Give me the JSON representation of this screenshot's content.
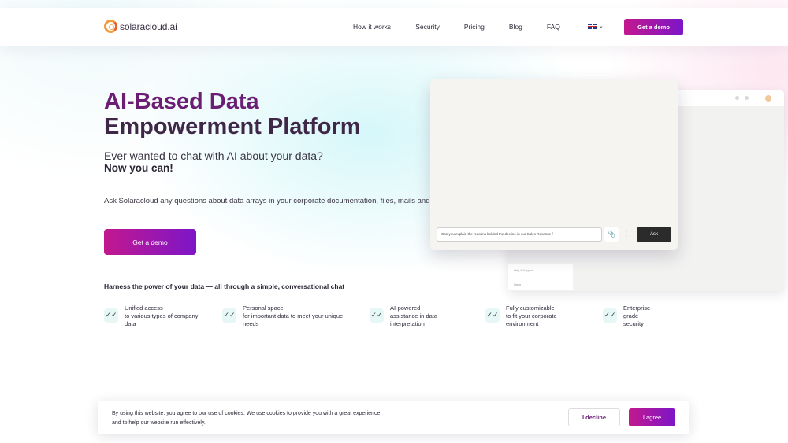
{
  "header": {
    "logo_text": "solaracloud.ai",
    "nav": [
      "How it works",
      "Security",
      "Pricing",
      "Blog",
      "FAQ"
    ],
    "language": "English",
    "demo_label": "Get a demo"
  },
  "hero": {
    "title_line1": "AI-Based Data",
    "title_line2": "Empowerment Platform",
    "subtitle1": "Ever wanted to chat with AI about your data?",
    "subtitle2": "Now you can!",
    "description": "Ask Solaracloud any questions about data arrays in your corporate documentation, files, mails and c",
    "demo_label": "Get a demo",
    "harness": "Harness the power of your data — all through a simple, conversational chat"
  },
  "features": [
    {
      "l1": "Unified access",
      "l2": "to various types of company",
      "l3": "data"
    },
    {
      "l1": "Personal space",
      "l2": "for important data to meet your unique",
      "l3": "needs"
    },
    {
      "l1": "AI-powered",
      "l2": "assistance in data",
      "l3": "interpretation"
    },
    {
      "l1": "Fully customizable",
      "l2": "to fit your corporate",
      "l3": "environment"
    },
    {
      "l1": "Enterprise-",
      "l2": "grade",
      "l3": "security"
    }
  ],
  "preview": {
    "input_value": "Can you explain the reasons behind the decline in our Sales Revenue f",
    "ask_label": "Ask",
    "side_help": "Help & Support",
    "side_user": "Name"
  },
  "cookie": {
    "text_line1": "By using this website, you agree to our use of cookies. We use cookies to provide you with a great experience",
    "text_line2": "and to help our website run effectively.",
    "decline_label": "I decline",
    "agree_label": "I agree"
  },
  "colors": {
    "accent_start": "#c2188e",
    "accent_end": "#7c16c8",
    "title": "#6b1e74"
  }
}
